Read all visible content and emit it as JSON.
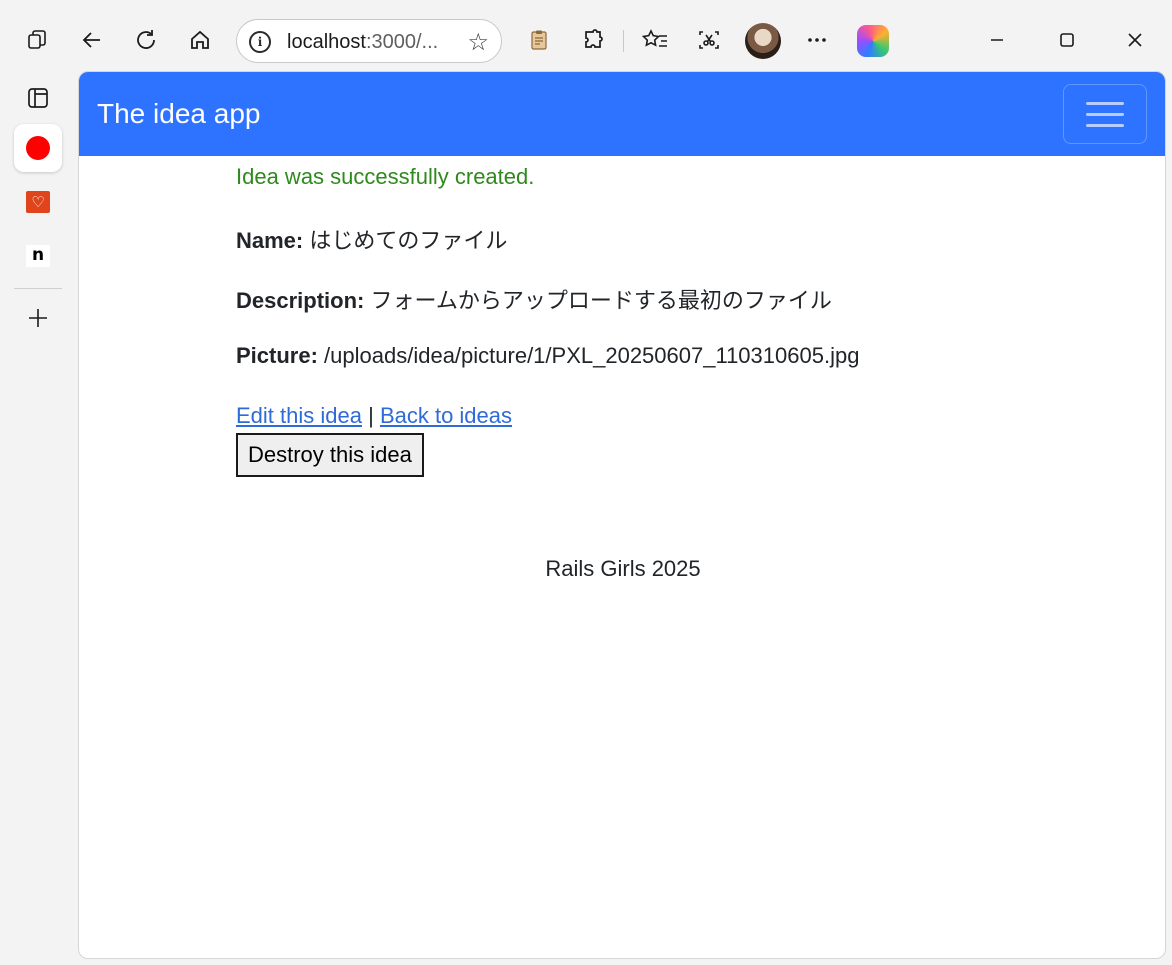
{
  "browser": {
    "address": {
      "host": "localhost",
      "rest": ":3000/..."
    }
  },
  "page": {
    "brand": "The idea app",
    "notice": "Idea was successfully created.",
    "fields": [
      {
        "label": "Name:",
        "value": "はじめてのファイル"
      },
      {
        "label": "Description:",
        "value": "フォームからアップロードする最初のファイル"
      },
      {
        "label": "Picture:",
        "value": "/uploads/idea/picture/1/PXL_20250607_110310605.jpg"
      }
    ],
    "links": {
      "edit": "Edit this idea",
      "separator": "|",
      "back": "Back to ideas"
    },
    "destroy_label": "Destroy this idea",
    "footer": "Rails Girls 2025"
  },
  "colors": {
    "navbar": "#2e73ff",
    "notice": "#2e8a1c",
    "link": "#2e6bd6"
  }
}
